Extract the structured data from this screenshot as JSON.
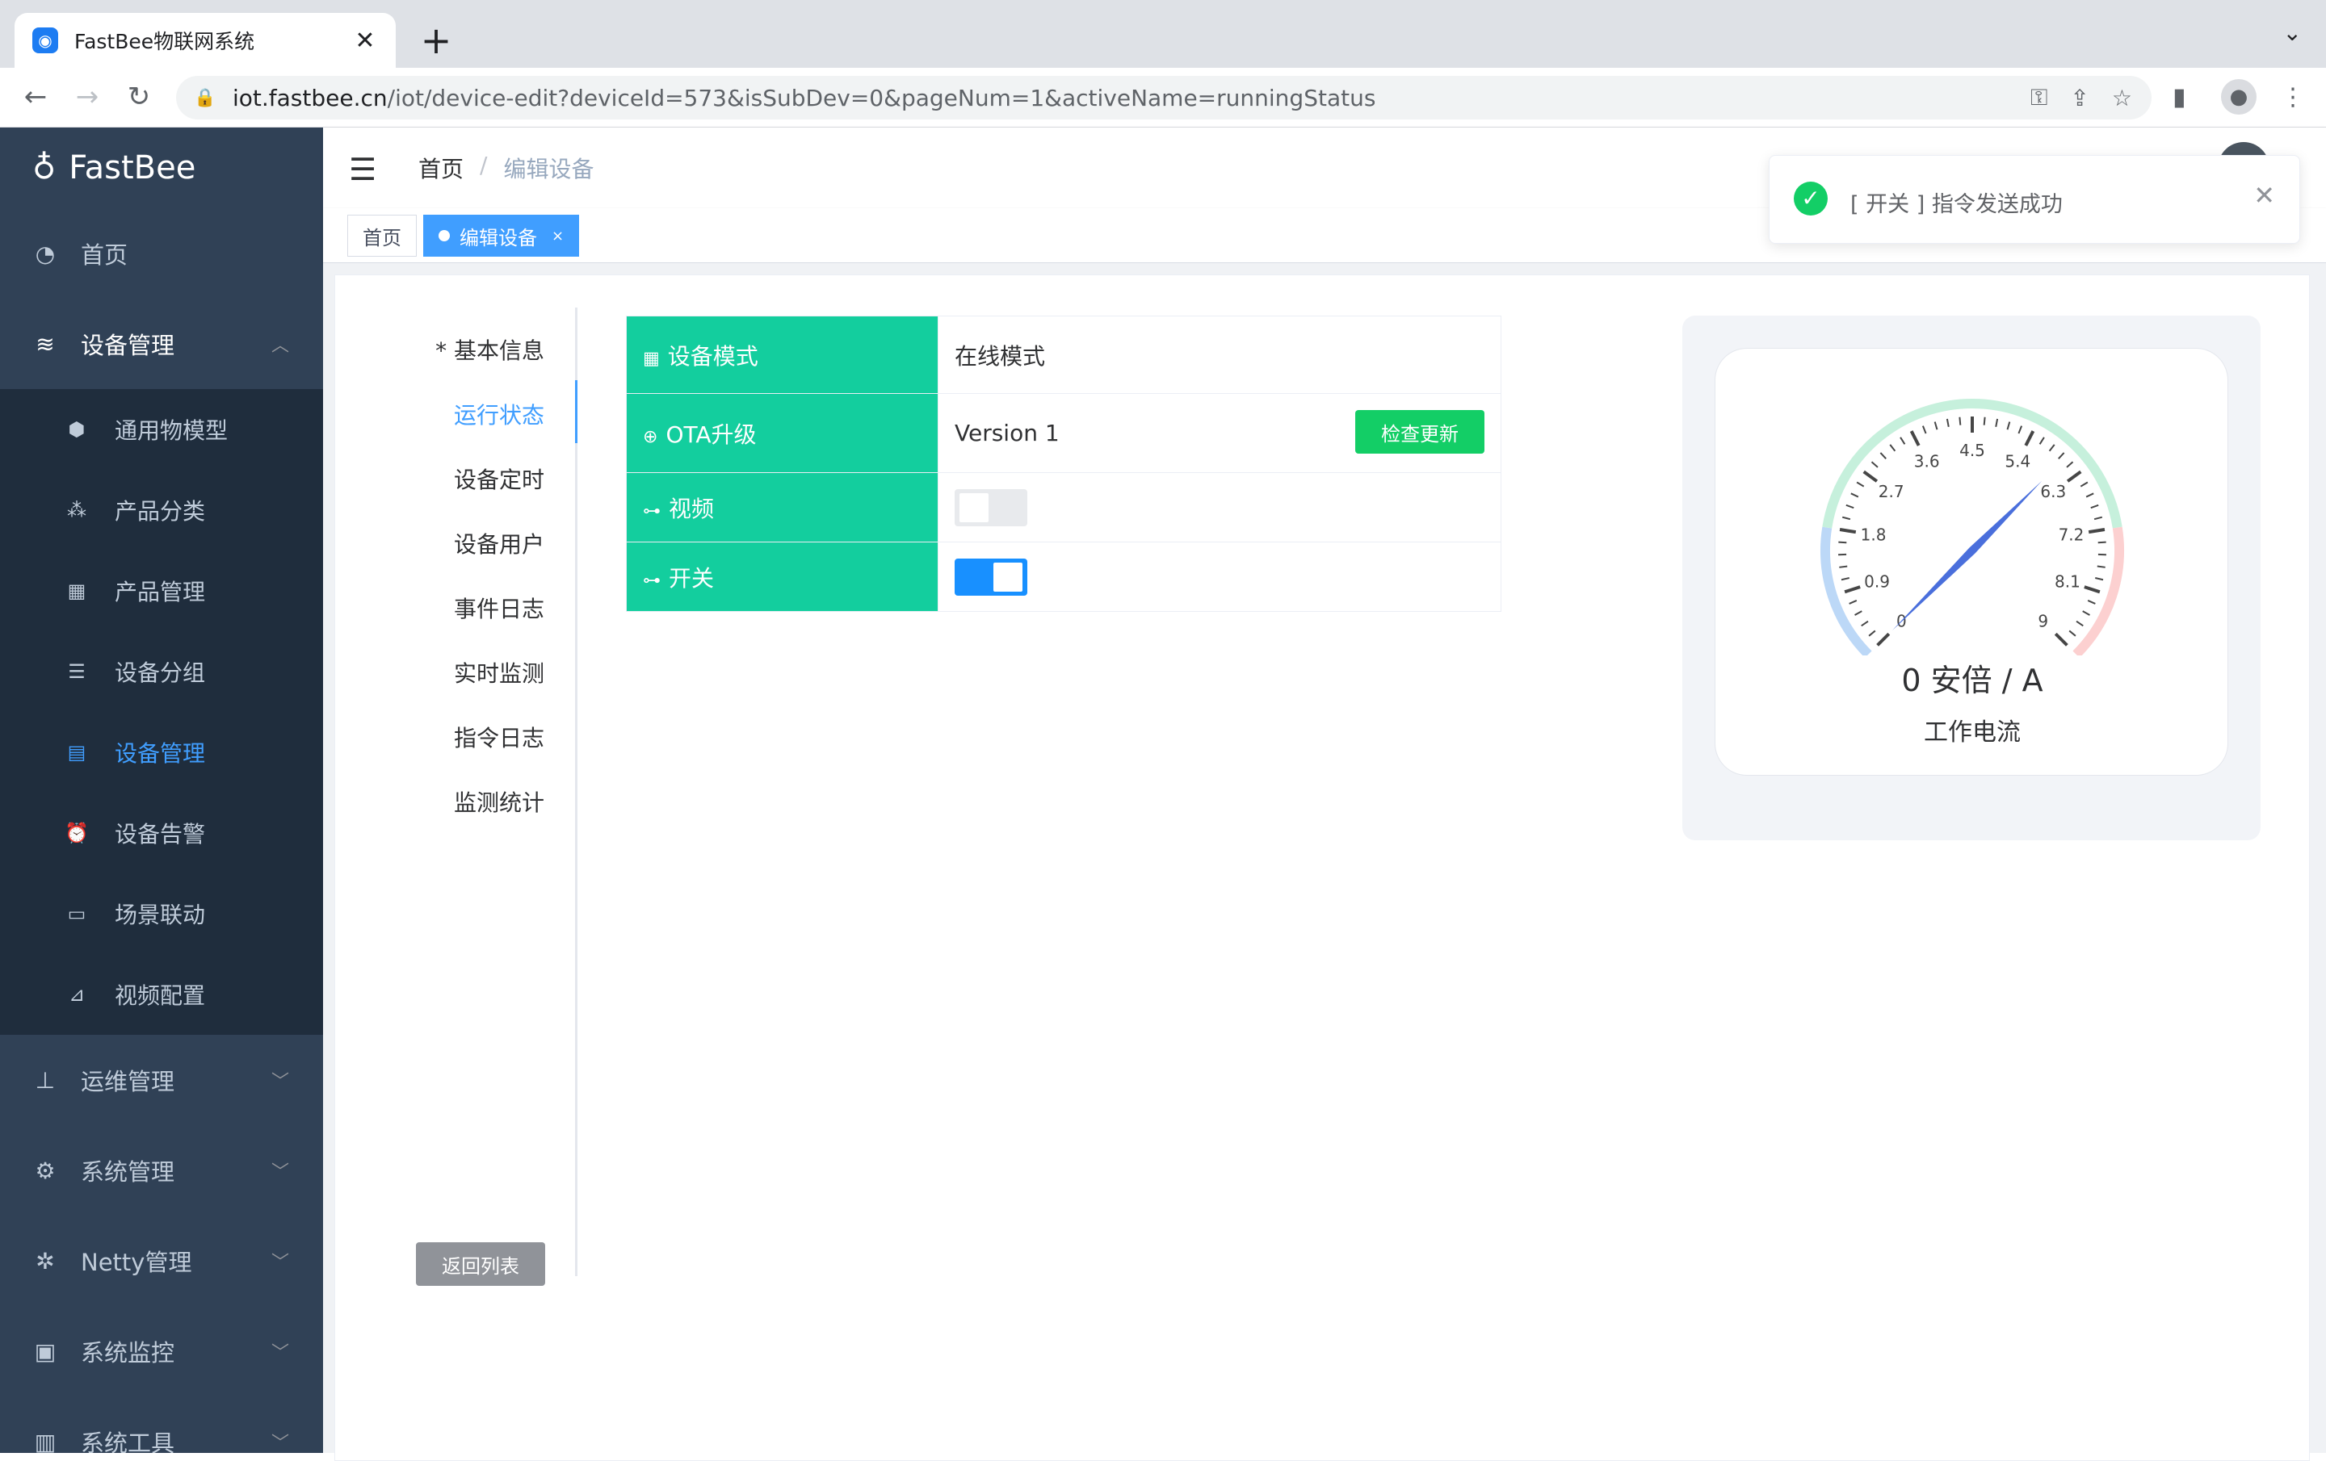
{
  "browser": {
    "tab_title": "FastBee物联网系统",
    "tab_close": "✕",
    "new_tab": "+",
    "url_host": "iot.fastbee.cn",
    "url_path": "/iot/device-edit?deviceId=573&isSubDev=0&pageNum=1&activeName=runningStatus"
  },
  "sidebar": {
    "brand": "FastBee",
    "items": [
      {
        "label": "首页",
        "icon": "dashboard-icon"
      },
      {
        "label": "设备管理",
        "icon": "layers-icon"
      }
    ],
    "sub_items": [
      {
        "label": "通用物模型",
        "icon": "cube-icon"
      },
      {
        "label": "产品分类",
        "icon": "tree-icon"
      },
      {
        "label": "产品管理",
        "icon": "grid-icon"
      },
      {
        "label": "设备分组",
        "icon": "list-icon"
      },
      {
        "label": "设备管理",
        "icon": "server-icon"
      },
      {
        "label": "设备告警",
        "icon": "alarm-icon"
      },
      {
        "label": "场景联动",
        "icon": "scene-icon"
      },
      {
        "label": "视频配置",
        "icon": "camera-icon"
      }
    ],
    "bottom_items": [
      {
        "label": "运维管理",
        "icon": "sitemap-icon"
      },
      {
        "label": "系统管理",
        "icon": "gear-icon"
      },
      {
        "label": "Netty管理",
        "icon": "network-icon"
      },
      {
        "label": "系统监控",
        "icon": "monitor-icon"
      },
      {
        "label": "系统工具",
        "icon": "toolbox-icon"
      }
    ]
  },
  "navbar": {
    "breadcrumb_home": "首页",
    "breadcrumb_sep": "/",
    "breadcrumb_current": "编辑设备"
  },
  "tags": {
    "home": "首页",
    "current": "编辑设备",
    "close": "×"
  },
  "vtabs": {
    "items": [
      "* 基本信息",
      "运行状态",
      "设备定时",
      "设备用户",
      "事件日志",
      "实时监测",
      "指令日志",
      "监测统计"
    ],
    "back_button": "返回列表"
  },
  "status_table": {
    "rows": [
      {
        "label": "设备模式",
        "value": "在线模式"
      },
      {
        "label": "OTA升级",
        "value": "Version 1",
        "button": "检查更新"
      },
      {
        "label": "视频",
        "switch_on": false
      },
      {
        "label": "开关",
        "switch_on": true
      }
    ]
  },
  "gauge": {
    "value": 0,
    "min": 0,
    "max": 9,
    "ticks": [
      "0",
      "0.9",
      "1.8",
      "2.7",
      "3.6",
      "4.5",
      "5.4",
      "6.3",
      "7.2",
      "8.1",
      "9"
    ],
    "value_text": "0 安倍 / A",
    "name": "工作电流",
    "colors": {
      "low": "#bcd8f7",
      "mid": "#c6f0dc",
      "high": "#fcd0d0",
      "pointer": "#4a6fdc"
    }
  },
  "toast": {
    "message": "[ 开关 ] 指令发送成功",
    "close": "✕"
  }
}
